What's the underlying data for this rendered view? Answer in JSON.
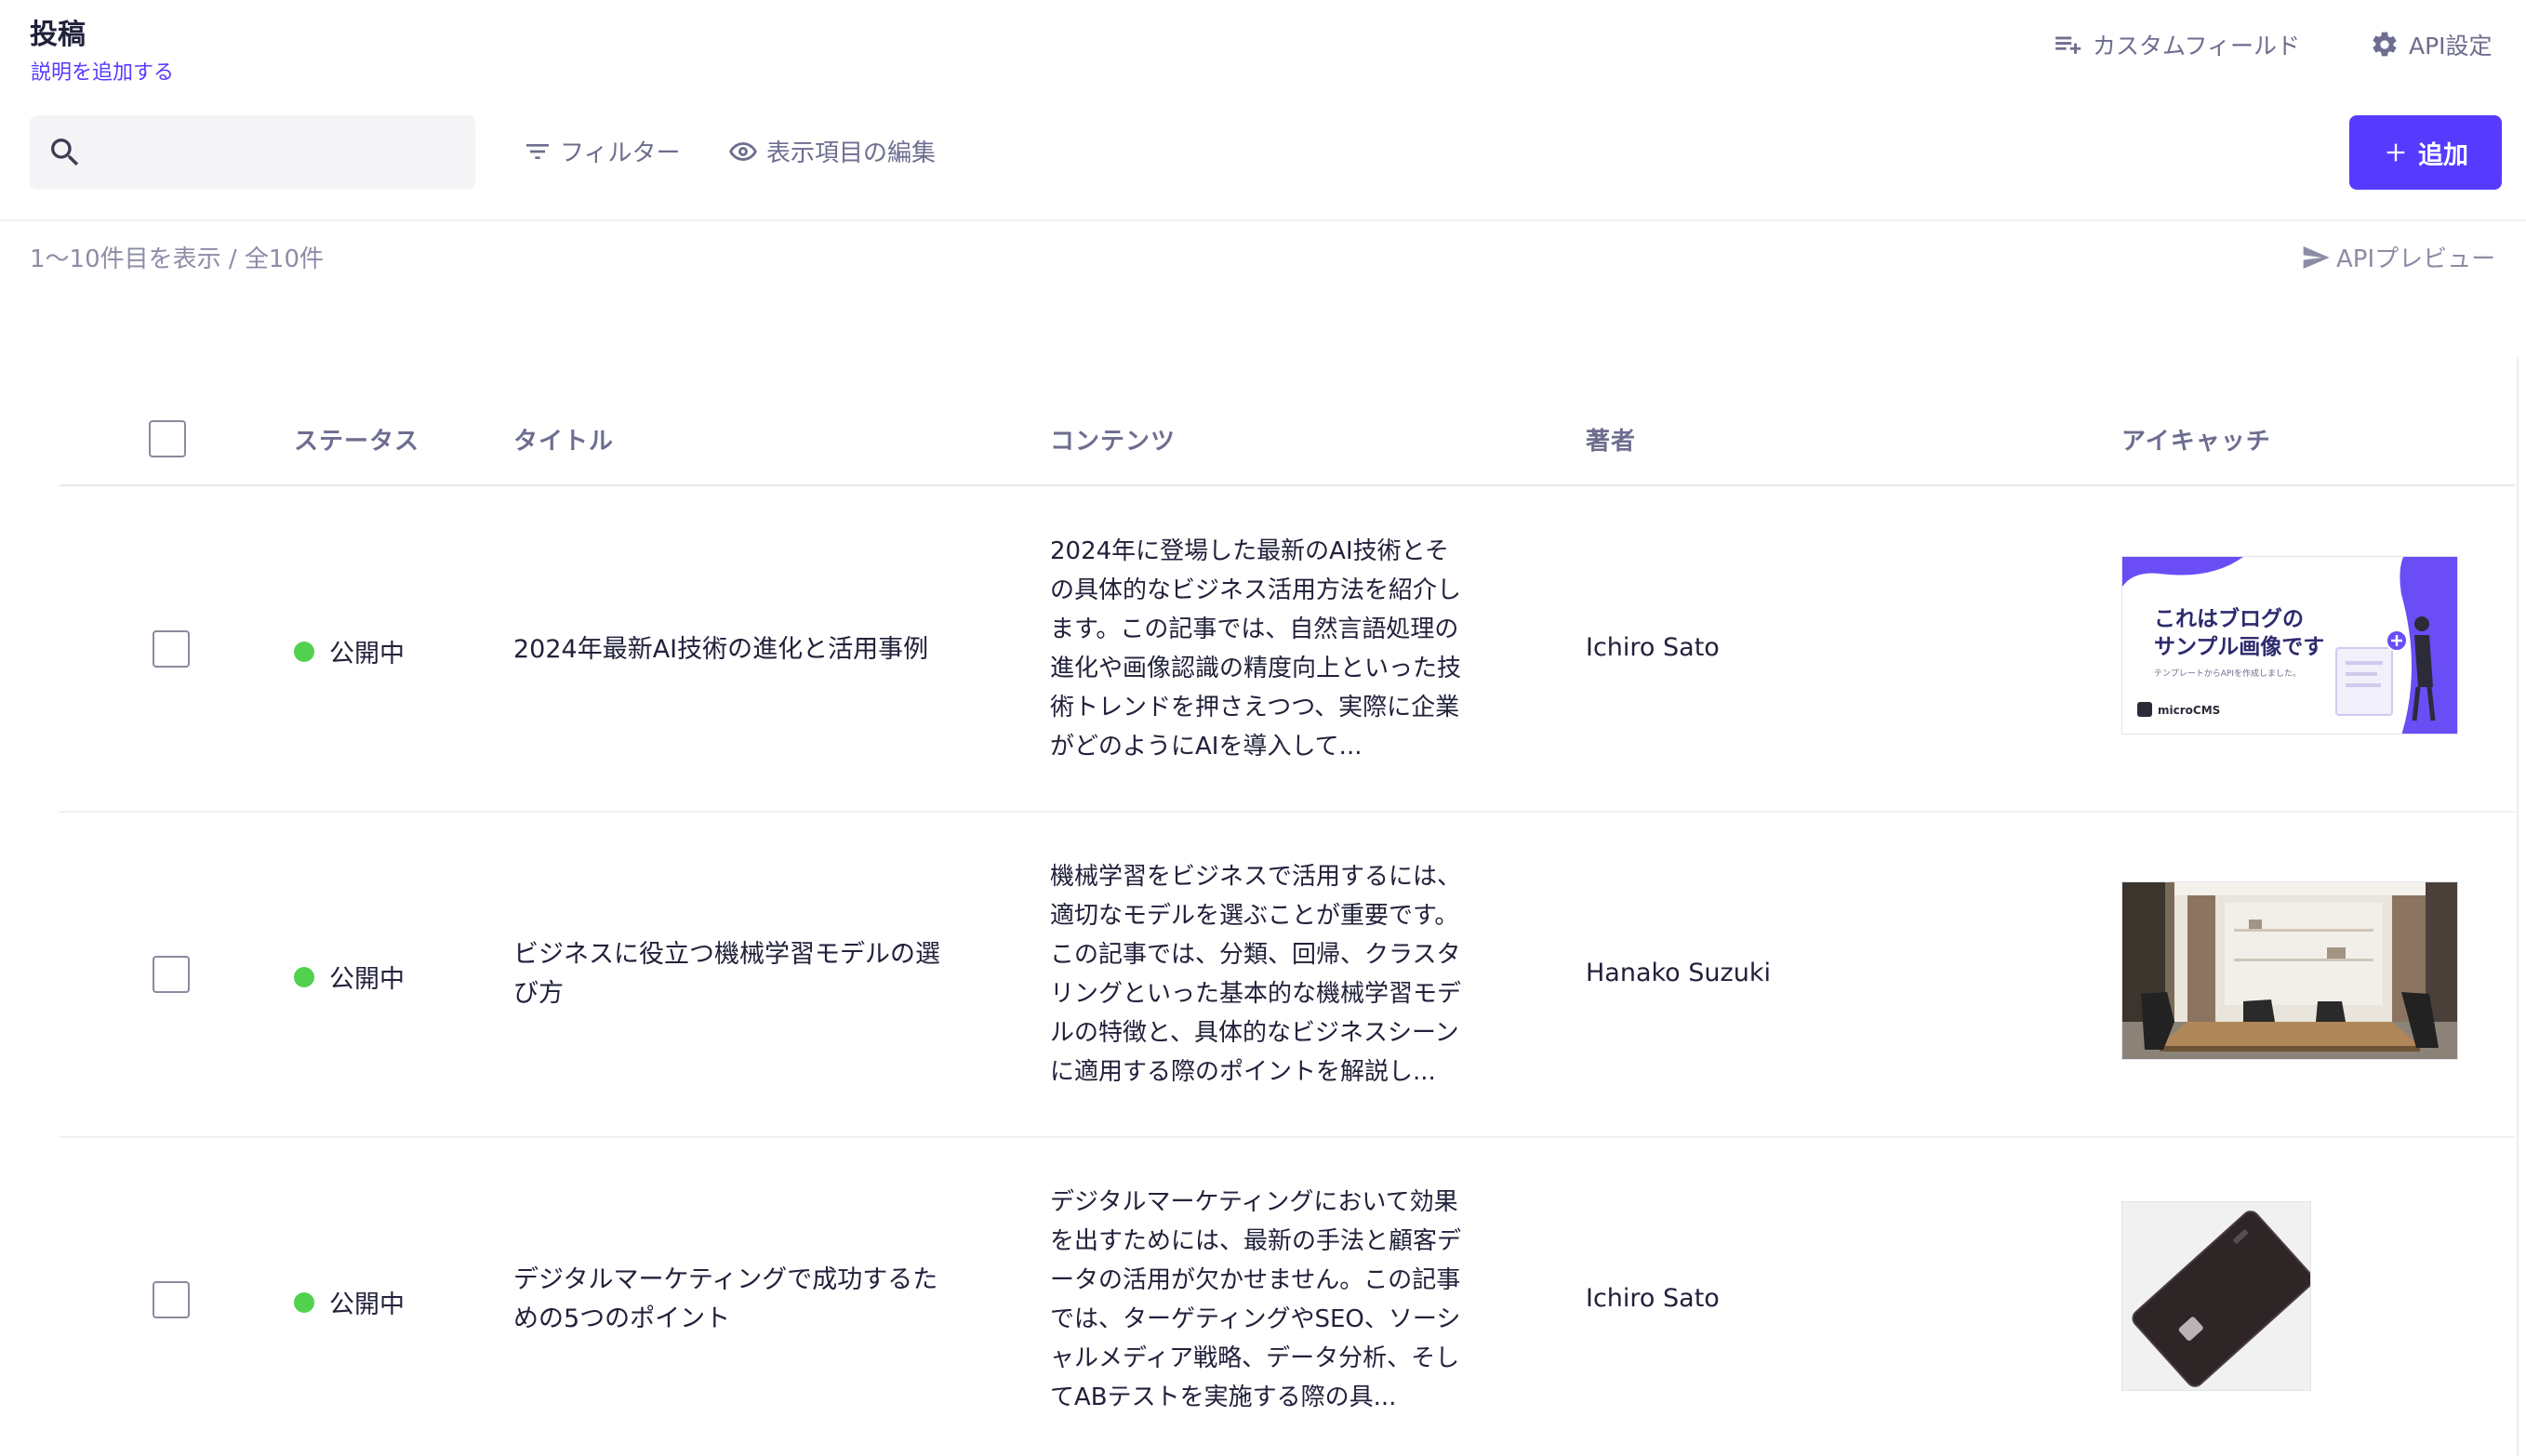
{
  "header": {
    "title": "投稿",
    "description": "説明を追加する",
    "custom_fields_label": "カスタムフィールド",
    "api_settings_label": "API設定"
  },
  "toolbar": {
    "search_value": "",
    "filter_label": "フィルター",
    "columns_label": "表示項目の編集",
    "add_label": "追加"
  },
  "result_info": {
    "count_text": "1〜10件目を表示 / 全10件",
    "api_preview_label": "APIプレビュー"
  },
  "table": {
    "columns": [
      "ステータス",
      "タイトル",
      "コンテンツ",
      "著者",
      "アイキャッチ"
    ],
    "rows": [
      {
        "status": "公開中",
        "title_lines": [
          "2024年最新AI技術の進化と活用事例"
        ],
        "content_lines": [
          "2024年に登場した最新のAI技術とそ",
          "の具体的なビジネス活用方法を紹介し",
          "ます。この記事では、自然言語処理の",
          "進化や画像認識の精度向上といった技",
          "術トレンドを押さえつつ、実際に企業",
          "がどのようにAIを導入して..."
        ],
        "author": "Ichiro Sato",
        "thumb_text": [
          "これはブログの",
          "サンプル画像です"
        ],
        "thumb_small": "テンプレートからAPIを作成しました。",
        "thumb_brand": "microCMS"
      },
      {
        "status": "公開中",
        "title_lines": [
          "ビジネスに役立つ機械学習モデルの選",
          "び方"
        ],
        "content_lines": [
          "機械学習をビジネスで活用するには、",
          "適切なモデルを選ぶことが重要です。",
          "この記事では、分類、回帰、クラスタ",
          "リングといった基本的な機械学習モデ",
          "ルの特徴と、具体的なビジネスシーン",
          "に適用する際のポイントを解説し..."
        ],
        "author": "Hanako Suzuki"
      },
      {
        "status": "公開中",
        "title_lines": [
          "デジタルマーケティングで成功するた",
          "めの5つのポイント"
        ],
        "content_lines": [
          "デジタルマーケティングにおいて効果",
          "を出すためには、最新の手法と顧客デ",
          "ータの活用が欠かせません。この記事",
          "では、ターゲティングやSEO、ソーシ",
          "ャルメディア戦略、データ分析、そし",
          "てABテストを実施する際の具..."
        ],
        "author": "Ichiro Sato"
      }
    ]
  },
  "colors": {
    "accent": "#563bff",
    "status_published": "#52d14f",
    "muted_text": "#6d6d8f"
  },
  "icons": [
    "search-icon",
    "playlist-add-icon",
    "gear-icon",
    "filter-icon",
    "eye-icon",
    "plus-icon",
    "send-icon"
  ]
}
